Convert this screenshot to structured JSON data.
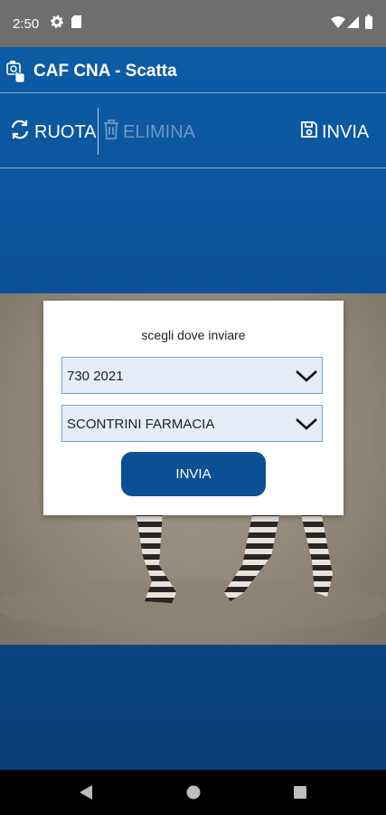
{
  "status_bar": {
    "time": "2:50"
  },
  "header": {
    "title": "CAF CNA - Scatta"
  },
  "toolbar": {
    "rotate_label": "RUOTA",
    "delete_label": "ELIMINA",
    "send_label": "INVIA"
  },
  "dialog": {
    "prompt": "scegli dove inviare",
    "year_select": {
      "value": "730 2021"
    },
    "category_select": {
      "value": "SCONTRINI FARMACIA"
    },
    "send_label": "INVIA"
  },
  "colors": {
    "app_blue": "#0b4d8d",
    "dialog_button": "#0b4f94",
    "select_fill": "#e4eefa"
  }
}
